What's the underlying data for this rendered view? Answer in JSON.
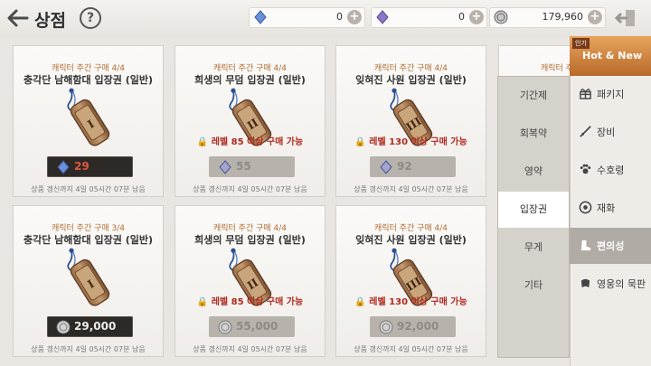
{
  "header": {
    "title": "상점",
    "help": "?"
  },
  "currencies": [
    {
      "icon": "blue-crystal-icon",
      "amount": "0"
    },
    {
      "icon": "purple-crystal-icon",
      "amount": "0"
    },
    {
      "icon": "silver-coin-icon",
      "amount": "179,960"
    }
  ],
  "cards": [
    {
      "limit": "캐릭터 주간 구매 4/4",
      "name": "충각단 남해함대 입장권 (일반)",
      "numeral": "I",
      "req": "",
      "price": "29",
      "currency": "crystal",
      "refresh": "상품 갱신까지 4일 05시간 07분 남음"
    },
    {
      "limit": "캐릭터 주간 구매 4/4",
      "name": "희생의 무덤 입장권 (일반)",
      "numeral": "II",
      "req": "레벨 85 이상 구매 가능",
      "price": "55",
      "currency": "crystal",
      "refresh": "상품 갱신까지 4일 05시간 07분 남음"
    },
    {
      "limit": "캐릭터 주간 구매 4/4",
      "name": "잊혀진 사원 입장권 (일반)",
      "numeral": "III",
      "req": "레벨 130 이상 구매 가능",
      "price": "92",
      "currency": "crystal",
      "refresh": "상품 갱신까지 4일 05시간 07분 남음"
    },
    {
      "limit": "캐릭터 주간 구매 3/4",
      "name": "충각단 남해함대 입장권 (일반)",
      "numeral": "I",
      "req": "",
      "price": "29,000",
      "currency": "coin",
      "refresh": "상품 갱신까지 4일 05시간 07분 남음"
    },
    {
      "limit": "캐릭터 주간 구매 4/4",
      "name": "희생의 무덤 입장권 (일반)",
      "numeral": "II",
      "req": "레벨 85 이상 구매 가능",
      "price": "55,000",
      "currency": "coin",
      "refresh": "상품 갱신까지 4일 05시간 07분 남음"
    },
    {
      "limit": "캐릭터 주간 구매 4/4",
      "name": "잊혀진 사원 입장권 (일반)",
      "numeral": "III",
      "req": "레벨 130 이상 구매 가능",
      "price": "92,000",
      "currency": "coin",
      "refresh": "상품 갱신까지 4일 05시간 07분 남음"
    }
  ],
  "partial_card": {
    "limit": "캐릭터 주"
  },
  "submenu": {
    "items": [
      "기간제",
      "회복약",
      "영약",
      "입장권",
      "무게",
      "기타"
    ],
    "selected": "입장권"
  },
  "sidebar": {
    "hot": {
      "tag": "인기",
      "label": "Hot & New"
    },
    "items": [
      {
        "label": "패키지",
        "icon": "gift-icon"
      },
      {
        "label": "장비",
        "icon": "sword-icon"
      },
      {
        "label": "수호령",
        "icon": "paw-icon"
      },
      {
        "label": "재화",
        "icon": "coin-icon"
      },
      {
        "label": "편의성",
        "icon": "boot-icon"
      },
      {
        "label": "영웅의 묵판",
        "icon": "scroll-icon"
      }
    ],
    "selected": "편의성"
  }
}
